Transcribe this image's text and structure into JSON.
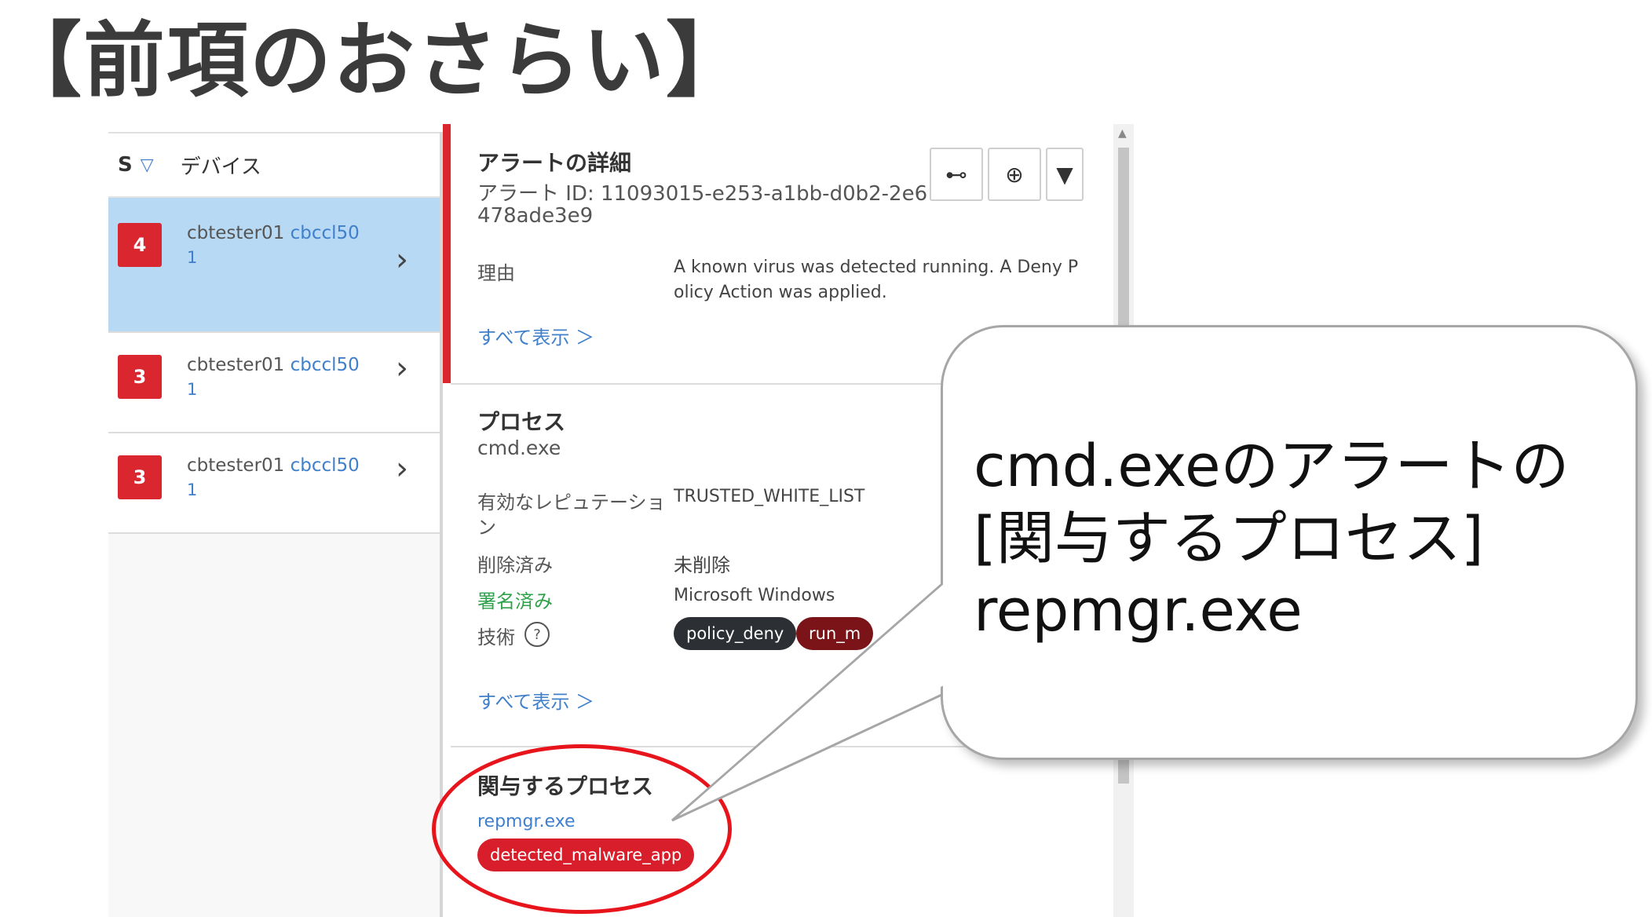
{
  "slide_title": "【前項のおさらい】",
  "alert_list": {
    "col_s": "S",
    "col_device": "デバイス",
    "rows": [
      {
        "severity": "4",
        "host": "cbtester01",
        "device": "cbccl50",
        "device_num": "1"
      },
      {
        "severity": "3",
        "host": "cbtester01",
        "device": "cbccl50",
        "device_num": "1"
      },
      {
        "severity": "3",
        "host": "cbtester01",
        "device": "cbccl50",
        "device_num": "1"
      }
    ]
  },
  "alert_detail": {
    "title": "アラートの詳細",
    "alert_id_line1": "アラート ID: 11093015-e253-a1bb-d0b2-2e6",
    "alert_id_line2": "478ade3e9",
    "reason_label": "理由",
    "reason_line1": "A known virus was detected running. A Deny P",
    "reason_line2": "olicy Action was applied.",
    "show_all": "すべて表示 ＞"
  },
  "process": {
    "title": "プロセス",
    "name": "cmd.exe",
    "reputation_label_line1": "有効なレピュテーショ",
    "reputation_label_line2": "ン",
    "reputation_value": "TRUSTED_WHITE_LIST",
    "deleted_label": "削除済み",
    "deleted_value": "未削除",
    "signed_label": "署名済み",
    "signed_value": "Microsoft Windows",
    "tech_label": "技術",
    "tags": [
      "policy_deny",
      "run_m"
    ],
    "show_all": "すべて表示 ＞"
  },
  "involved_process": {
    "title": "関与するプロセス",
    "name": "repmgr.exe",
    "tag": "detected_malware_app"
  },
  "callout": {
    "line1": "cmd.exeのアラートの",
    "line2": "[関与するプロセス]",
    "line3": "repmgr.exe"
  },
  "colors": {
    "severity_red": "#d9262f",
    "selected_row": "#b8d9f3",
    "link_blue": "#3f7fcc",
    "highlight_circle": "#e8141c"
  },
  "icons": [
    "sort-down-icon",
    "chevron-right-icon",
    "process-tree-icon",
    "target-icon",
    "dropdown-icon",
    "help-icon"
  ]
}
